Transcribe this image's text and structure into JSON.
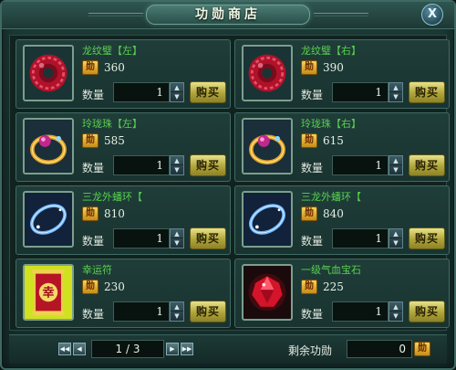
{
  "window": {
    "title": "功勋商店",
    "close_icon": "close-icon",
    "close_glyph": "X"
  },
  "currency_glyph": "勋",
  "quantity_label": "数量",
  "buy_label": "购买",
  "items": [
    {
      "name": "龙纹璧【左】",
      "price": "360",
      "quantity": "1",
      "icon": "red-jade-disc-icon"
    },
    {
      "name": "龙纹璧【右】",
      "price": "390",
      "quantity": "1",
      "icon": "red-jade-disc-icon"
    },
    {
      "name": "玲珑珠【左】",
      "price": "585",
      "quantity": "1",
      "icon": "gold-gem-ring-icon"
    },
    {
      "name": "玲珑珠【右】",
      "price": "615",
      "quantity": "1",
      "icon": "gold-gem-ring-icon"
    },
    {
      "name": "三龙外蟠环【",
      "price": "810",
      "quantity": "1",
      "icon": "blue-ring-icon"
    },
    {
      "name": "三龙外蟠环【",
      "price": "840",
      "quantity": "1",
      "icon": "blue-ring-icon"
    },
    {
      "name": "幸运符",
      "price": "230",
      "quantity": "1",
      "icon": "lucky-charm-scroll-icon"
    },
    {
      "name": "一级气血宝石",
      "price": "225",
      "quantity": "1",
      "icon": "red-gemstone-icon"
    }
  ],
  "lucky_charm_glyph": "幸",
  "pagination": {
    "page": "1 / 3"
  },
  "remaining": {
    "label": "剩余功勋",
    "value": "0"
  },
  "colors": {
    "item_name": "#59d14f",
    "buy_button": "#d8d070",
    "panel": "#1f3d39"
  }
}
